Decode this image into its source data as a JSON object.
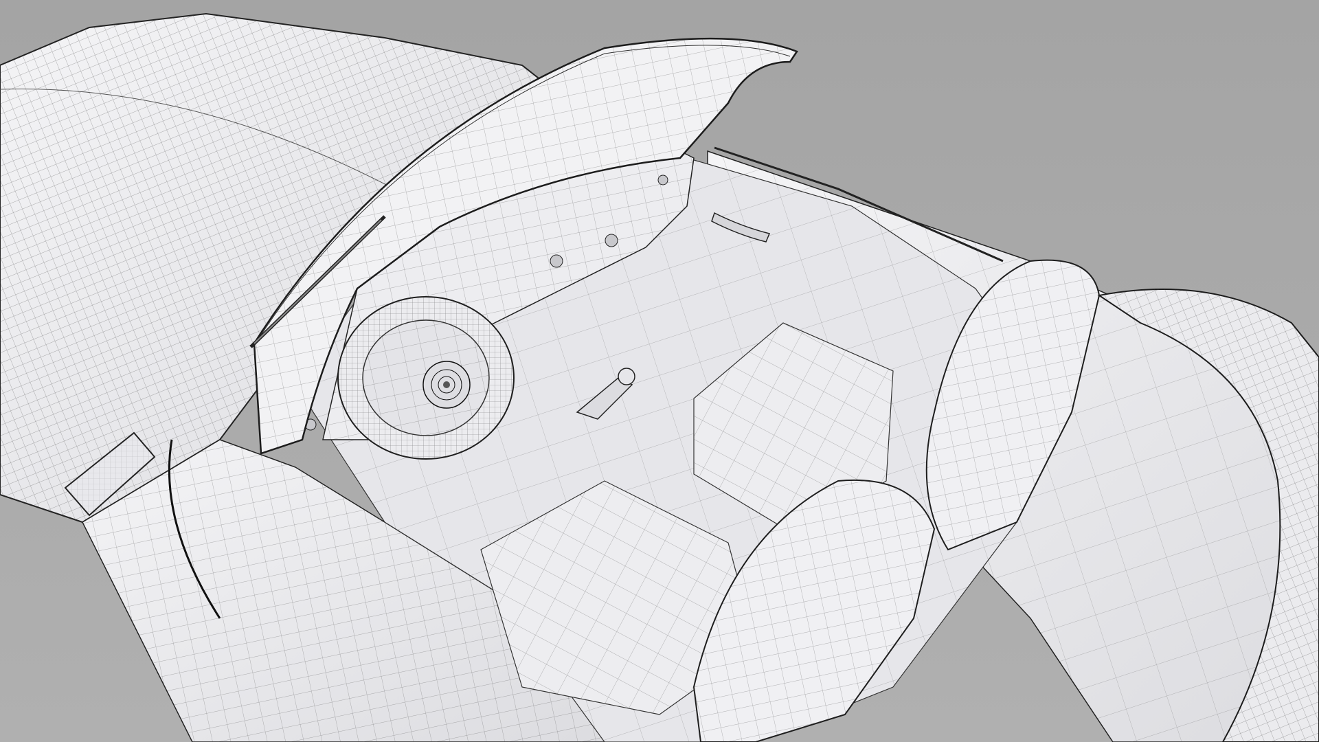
{
  "scene": {
    "subject": "car-clay-wireframe-render",
    "colors": {
      "background": "#a8a8a8",
      "surface": "#eeeef0",
      "surface_shade": "#d6d6da",
      "interior": "#e7e7ea",
      "wire": "#3a3a3a",
      "outline": "#1c1c1c"
    }
  }
}
